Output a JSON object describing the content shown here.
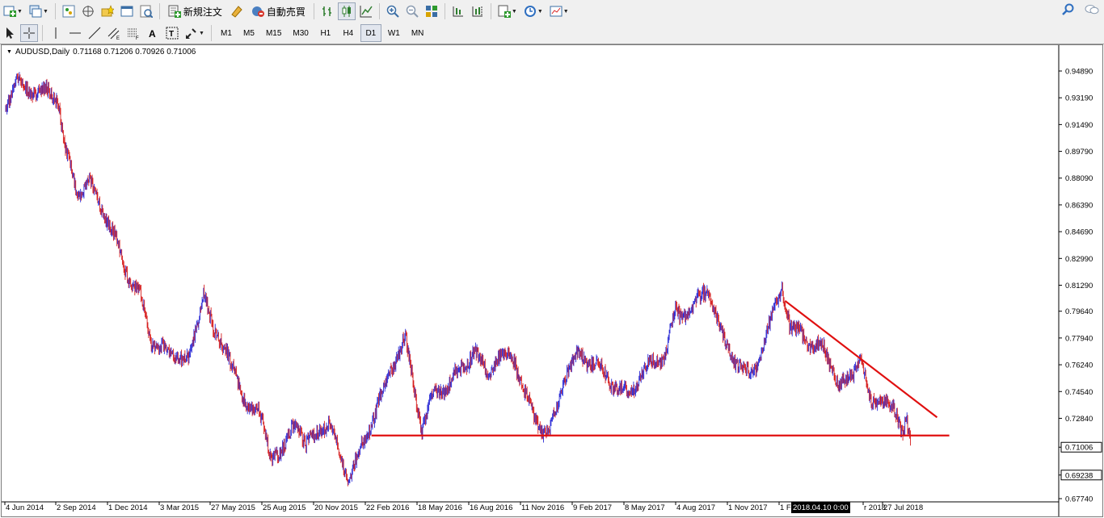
{
  "toolbar": {
    "new_order_label": "新規注文",
    "auto_trade_label": "自動売買"
  },
  "timeframes": [
    "M1",
    "M5",
    "M15",
    "M30",
    "H1",
    "H4",
    "D1",
    "W1",
    "MN"
  ],
  "active_timeframe": "D1",
  "symbol": {
    "name": "AUDUSD,Daily",
    "ohlc": "0.71168 0.71206 0.70926 0.71006"
  },
  "colors": {
    "bull": "#2b2bd6",
    "bear": "#d61d1d",
    "trendline": "#e01010"
  },
  "price_labels": [
    "0.94890",
    "0.93190",
    "0.91490",
    "0.89790",
    "0.88090",
    "0.86390",
    "0.84690",
    "0.82990",
    "0.81290",
    "0.79640",
    "0.77940",
    "0.76240",
    "0.74540",
    "0.72840",
    "0.71006",
    "0.69238",
    "0.67740"
  ],
  "current_price": "0.71006",
  "marked_price": "0.69238",
  "date_labels": [
    "4 Jun 2014",
    "2 Sep 2014",
    "1 Dec 2014",
    "3 Mar 2015",
    "27 May 2015",
    "25 Aug 2015",
    "20 Nov 2015",
    "22 Feb 2016",
    "18 May 2016",
    "16 Aug 2016",
    "11 Nov 2016",
    "9 Feb 2017",
    "8 May 2017",
    "4 Aug 2017",
    "1 Nov 2017",
    "1 F",
    "2018.04.10 0:00",
    "r 2018",
    "27 Jul 2018"
  ],
  "chart_data": {
    "type": "candlestick",
    "symbol": "AUDUSD",
    "timeframe": "Daily",
    "ylim": [
      0.6774,
      0.9489
    ],
    "price_path": [
      {
        "date": "2014-06-04",
        "price": 0.93
      },
      {
        "date": "2014-06-25",
        "price": 0.944
      },
      {
        "date": "2014-07-20",
        "price": 0.937
      },
      {
        "date": "2014-08-10",
        "price": 0.935
      },
      {
        "date": "2014-09-01",
        "price": 0.93
      },
      {
        "date": "2014-09-15",
        "price": 0.895
      },
      {
        "date": "2014-10-05",
        "price": 0.873
      },
      {
        "date": "2014-10-25",
        "price": 0.881
      },
      {
        "date": "2014-11-15",
        "price": 0.865
      },
      {
        "date": "2014-12-01",
        "price": 0.85
      },
      {
        "date": "2015-01-01",
        "price": 0.815
      },
      {
        "date": "2015-01-20",
        "price": 0.805
      },
      {
        "date": "2015-02-10",
        "price": 0.777
      },
      {
        "date": "2015-03-03",
        "price": 0.775
      },
      {
        "date": "2015-03-25",
        "price": 0.77
      },
      {
        "date": "2015-04-15",
        "price": 0.763
      },
      {
        "date": "2015-05-10",
        "price": 0.808
      },
      {
        "date": "2015-05-27",
        "price": 0.78
      },
      {
        "date": "2015-06-20",
        "price": 0.773
      },
      {
        "date": "2015-07-15",
        "price": 0.742
      },
      {
        "date": "2015-08-10",
        "price": 0.735
      },
      {
        "date": "2015-09-01",
        "price": 0.703
      },
      {
        "date": "2015-09-25",
        "price": 0.706
      },
      {
        "date": "2015-10-15",
        "price": 0.73
      },
      {
        "date": "2015-11-01",
        "price": 0.712
      },
      {
        "date": "2015-11-20",
        "price": 0.722
      },
      {
        "date": "2015-12-10",
        "price": 0.725
      },
      {
        "date": "2016-01-15",
        "price": 0.686
      },
      {
        "date": "2016-02-05",
        "price": 0.71
      },
      {
        "date": "2016-03-05",
        "price": 0.74
      },
      {
        "date": "2016-03-25",
        "price": 0.76
      },
      {
        "date": "2016-04-20",
        "price": 0.778
      },
      {
        "date": "2016-05-18",
        "price": 0.72
      },
      {
        "date": "2016-06-10",
        "price": 0.745
      },
      {
        "date": "2016-07-01",
        "price": 0.75
      },
      {
        "date": "2016-07-20",
        "price": 0.76
      },
      {
        "date": "2016-08-16",
        "price": 0.77
      },
      {
        "date": "2016-09-10",
        "price": 0.755
      },
      {
        "date": "2016-10-01",
        "price": 0.766
      },
      {
        "date": "2016-10-25",
        "price": 0.767
      },
      {
        "date": "2016-11-11",
        "price": 0.745
      },
      {
        "date": "2016-12-10",
        "price": 0.722
      },
      {
        "date": "2016-12-25",
        "price": 0.719
      },
      {
        "date": "2017-01-20",
        "price": 0.754
      },
      {
        "date": "2017-02-09",
        "price": 0.768
      },
      {
        "date": "2017-03-15",
        "price": 0.765
      },
      {
        "date": "2017-04-10",
        "price": 0.752
      },
      {
        "date": "2017-05-08",
        "price": 0.742
      },
      {
        "date": "2017-06-10",
        "price": 0.76
      },
      {
        "date": "2017-07-10",
        "price": 0.77
      },
      {
        "date": "2017-07-28",
        "price": 0.8
      },
      {
        "date": "2017-08-04",
        "price": 0.795
      },
      {
        "date": "2017-09-01",
        "price": 0.8
      },
      {
        "date": "2017-09-20",
        "price": 0.809
      },
      {
        "date": "2017-10-15",
        "price": 0.78
      },
      {
        "date": "2017-11-01",
        "price": 0.77
      },
      {
        "date": "2017-11-25",
        "price": 0.758
      },
      {
        "date": "2017-12-10",
        "price": 0.76
      },
      {
        "date": "2018-01-05",
        "price": 0.785
      },
      {
        "date": "2018-01-26",
        "price": 0.812
      },
      {
        "date": "2018-02-10",
        "price": 0.782
      },
      {
        "date": "2018-03-01",
        "price": 0.785
      },
      {
        "date": "2018-03-20",
        "price": 0.774
      },
      {
        "date": "2018-04-10",
        "price": 0.776
      },
      {
        "date": "2018-05-05",
        "price": 0.747
      },
      {
        "date": "2018-05-20",
        "price": 0.752
      },
      {
        "date": "2018-06-10",
        "price": 0.764
      },
      {
        "date": "2018-06-28",
        "price": 0.738
      },
      {
        "date": "2018-07-15",
        "price": 0.742
      },
      {
        "date": "2018-07-27",
        "price": 0.74
      },
      {
        "date": "2018-08-10",
        "price": 0.733
      },
      {
        "date": "2018-08-22",
        "price": 0.722
      },
      {
        "date": "2018-08-28",
        "price": 0.731
      },
      {
        "date": "2018-09-05",
        "price": 0.71006
      }
    ],
    "support_line": {
      "price": 0.7175,
      "start_date": "2016-02-22",
      "end_date": "2018-11-10"
    },
    "resistance_line": {
      "start": {
        "date": "2018-02-01",
        "price": 0.803
      },
      "end": {
        "date": "2018-10-20",
        "price": 0.729
      }
    }
  }
}
